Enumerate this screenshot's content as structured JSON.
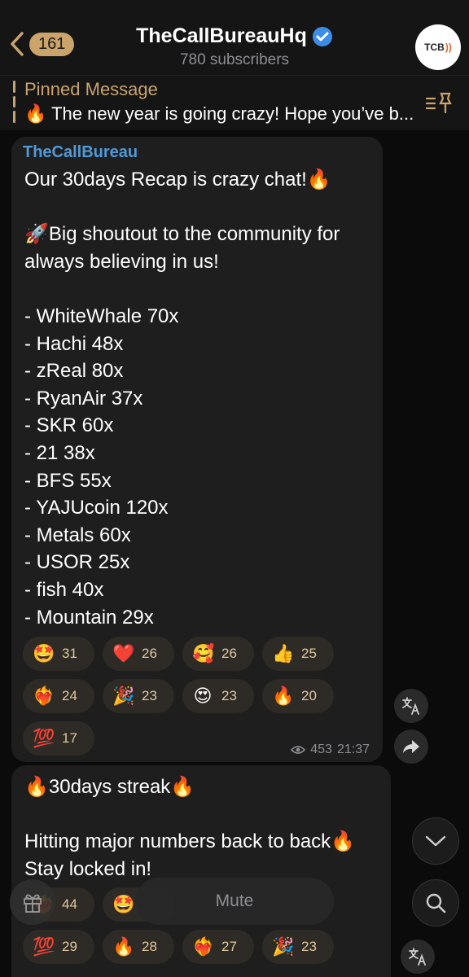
{
  "header": {
    "back_count": "161",
    "channel_name": "TheCallBureauHq",
    "subscribers": "780 subscribers",
    "avatar_text": "TCB"
  },
  "pinned": {
    "label": "Pinned Message",
    "text": "🔥 The new year is going crazy! Hope you’ve b..."
  },
  "message1": {
    "sender": "TheCallBureau",
    "text": "Our 30days Recap is crazy chat!🔥\n\n🚀Big shoutout to the community for always believing in us!\n\n- WhiteWhale 70x\n- Hachi 48x\n- zReal 80x\n- RyanAir 37x\n- SKR  60x\n- 21  38x\n- BFS   55x\n- YAJUcoin  120x\n- Metals  60x\n- USOR 25x\n- fish  40x\n- Mountain  29x",
    "reactions": [
      {
        "emoji": "🤩",
        "count": "31"
      },
      {
        "emoji": "❤️",
        "count": "26"
      },
      {
        "emoji": "🥰",
        "count": "26"
      },
      {
        "emoji": "👍",
        "count": "25"
      },
      {
        "emoji": "❤️‍🔥",
        "count": "24"
      },
      {
        "emoji": "🎉",
        "count": "23"
      },
      {
        "emoji": "😍",
        "count": "23"
      },
      {
        "emoji": "🔥",
        "count": "20"
      },
      {
        "emoji": "💯",
        "count": "17"
      }
    ],
    "views": "453",
    "time": "21:37"
  },
  "message2": {
    "text": "🔥30days streak🔥\n\nHitting major numbers back to back🔥\nStay locked in!",
    "reactions": [
      {
        "emoji": "❤️‍🔥",
        "count": "44"
      },
      {
        "emoji": "🤩",
        "count": ""
      },
      {
        "emoji": "💯",
        "count": "29"
      },
      {
        "emoji": "🔥",
        "count": "28"
      },
      {
        "emoji": "❤️‍🔥",
        "count": "27"
      },
      {
        "emoji": "🎉",
        "count": "23"
      }
    ]
  },
  "bottom": {
    "mute_label": "Mute"
  },
  "colors": {
    "accent": "#caa46a",
    "sender": "#4f9ad7",
    "bubble": "#1e1e1f"
  }
}
